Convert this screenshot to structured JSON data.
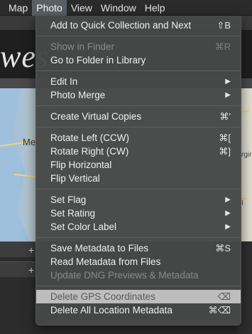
{
  "background": {
    "logo_text": "wes",
    "map_label": "Me",
    "map_label_right": "rgin",
    "map_label_right2": "I"
  },
  "menubar": {
    "items": [
      {
        "label": "Map"
      },
      {
        "label": "Photo"
      },
      {
        "label": "View"
      },
      {
        "label": "Window"
      },
      {
        "label": "Help"
      }
    ],
    "active": "Photo"
  },
  "menu": {
    "groups": [
      {
        "items": [
          {
            "label": "Add to Quick Collection and Next",
            "shortcut": "⇧B",
            "enabled": true
          },
          {
            "label": "Show in Finder",
            "shortcut": "⌘R",
            "enabled": false
          },
          {
            "label": "Go to Folder in Library",
            "shortcut": "",
            "enabled": true
          }
        ]
      },
      {
        "items": [
          {
            "label": "Edit In",
            "submenu": true,
            "enabled": true
          },
          {
            "label": "Photo Merge",
            "submenu": true,
            "enabled": true
          }
        ]
      },
      {
        "items": [
          {
            "label": "Create Virtual Copies",
            "shortcut": "⌘'",
            "enabled": true
          }
        ]
      },
      {
        "items": [
          {
            "label": "Rotate Left (CCW)",
            "shortcut": "⌘[",
            "enabled": true
          },
          {
            "label": "Rotate Right (CW)",
            "shortcut": "⌘]",
            "enabled": true
          },
          {
            "label": "Flip Horizontal",
            "shortcut": "",
            "enabled": true
          },
          {
            "label": "Flip Vertical",
            "shortcut": "",
            "enabled": true
          }
        ]
      },
      {
        "items": [
          {
            "label": "Set Flag",
            "submenu": true,
            "enabled": true
          },
          {
            "label": "Set Rating",
            "submenu": true,
            "enabled": true
          },
          {
            "label": "Set Color Label",
            "submenu": true,
            "enabled": true
          }
        ]
      },
      {
        "items": [
          {
            "label": "Save Metadata to Files",
            "shortcut": "⌘S",
            "enabled": true
          },
          {
            "label": "Read Metadata from Files",
            "shortcut": "",
            "enabled": true
          },
          {
            "label": "Update DNG Previews & Metadata",
            "shortcut": "",
            "enabled": false
          }
        ]
      },
      {
        "items": [
          {
            "label": "Delete GPS Coordinates",
            "shortcut": "⌫",
            "enabled": true,
            "highlighted": true
          },
          {
            "label": "Delete All Location Metadata",
            "shortcut": "⌘⌫",
            "enabled": true
          }
        ]
      }
    ],
    "submenu_arrow": "▶"
  },
  "colors": {
    "menu_bg": "#464848",
    "highlight_bg": "#bdbdbd",
    "active_menubar_bg": "#5b6068"
  }
}
